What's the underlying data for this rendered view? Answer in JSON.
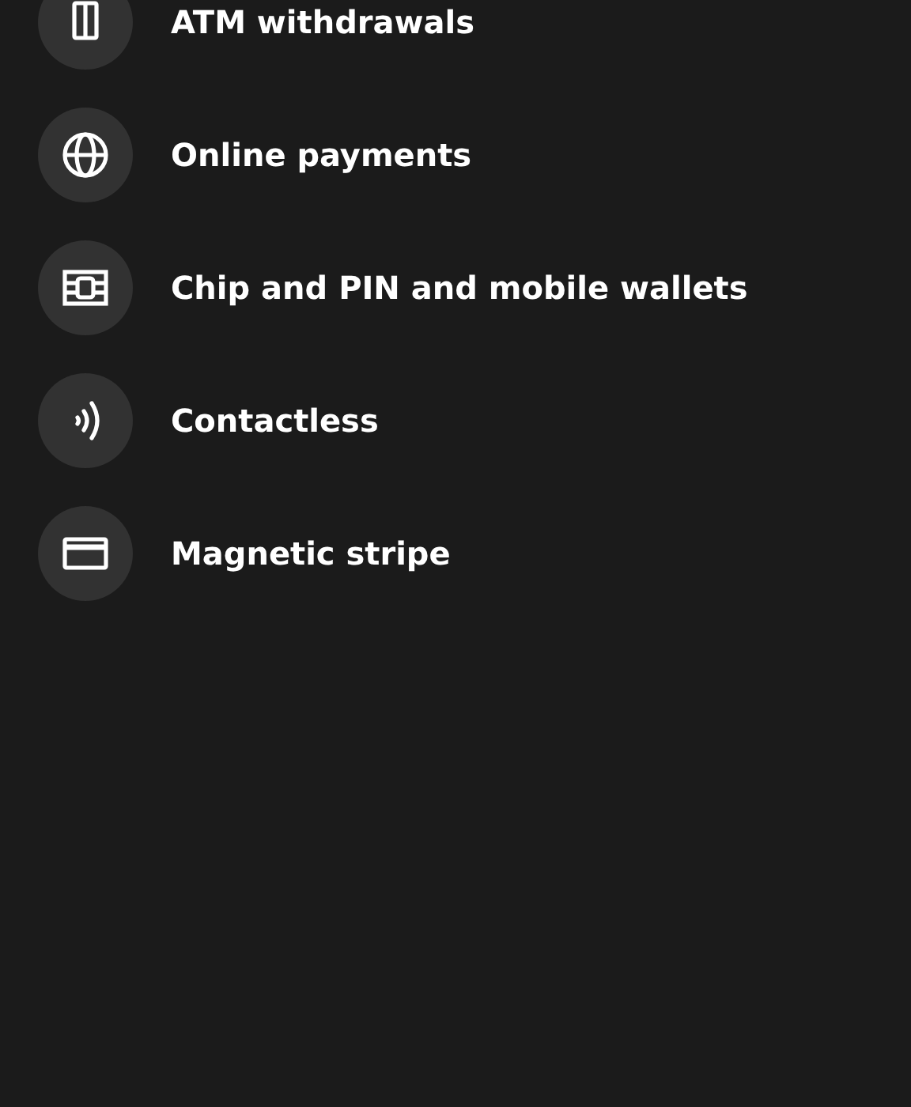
{
  "options": [
    {
      "kind": "atm",
      "label": "ATM withdrawals"
    },
    {
      "kind": "globe",
      "label": "Online payments"
    },
    {
      "kind": "chip",
      "label": "Chip and PIN and mobile wallets"
    },
    {
      "kind": "contactless",
      "label": "Contactless"
    },
    {
      "kind": "card",
      "label": "Magnetic stripe"
    }
  ]
}
